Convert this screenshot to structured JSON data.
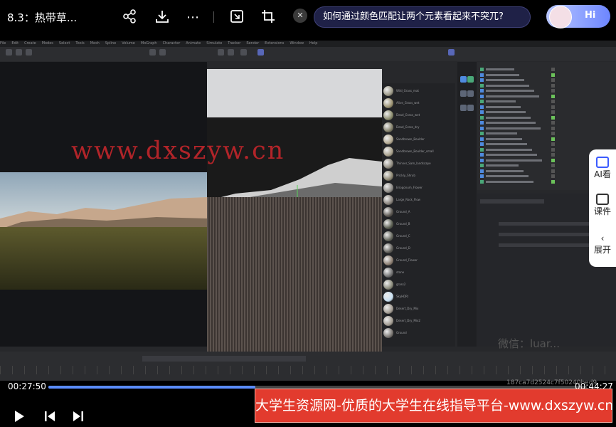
{
  "header": {
    "title": "8.3：热带草...",
    "question": "如何通过颜色匹配让两个元素看起来不突兀?",
    "assistant_label": "Hi"
  },
  "app": {
    "menu_items": [
      "File",
      "Edit",
      "Create",
      "Modes",
      "Select",
      "Tools",
      "Mesh",
      "Spline",
      "Volume",
      "MoGraph",
      "Character",
      "Animate",
      "Simulate",
      "Tracker",
      "Render",
      "Extensions",
      "Window",
      "Help"
    ],
    "materials": [
      "Wild_Grass_mat",
      "Alive_Grass_wet",
      "Dead_Grass_wet",
      "Dead_Grass_dry",
      "Sandbrown_Boulder",
      "Sandbrown_Boulder_small",
      "Thinner_Sam_landscape",
      "Prickly_Shrub",
      "Eriogonum_Flower",
      "Large_Rock_Flow",
      "Ground_A",
      "Ground_B",
      "Ground_C",
      "Ground_D",
      "Ground_Flower",
      "stone",
      "grass2",
      "SkyHDRI",
      "Desert_Dry_Mix",
      "Desert_Dry_Mix2",
      "Ground"
    ],
    "background_watermark": "微信：luar..."
  },
  "watermarks": {
    "site": "www.dxszyw.cn",
    "banner": "大学生资源网-优质的大学生在线指导平台-www.dxszyw.cn",
    "hash": "187ca7d2524c7f50240bed9"
  },
  "side_panel": {
    "ai_label": "AI看",
    "course_label": "课件",
    "expand_label": "展开"
  },
  "player": {
    "current_time": "00:27:50",
    "end_time": "00:44:27",
    "progress": 0.385
  },
  "colors": {
    "accent": "#5b8dff",
    "banner": "#e23b2e",
    "watermark": "#c3262b"
  }
}
